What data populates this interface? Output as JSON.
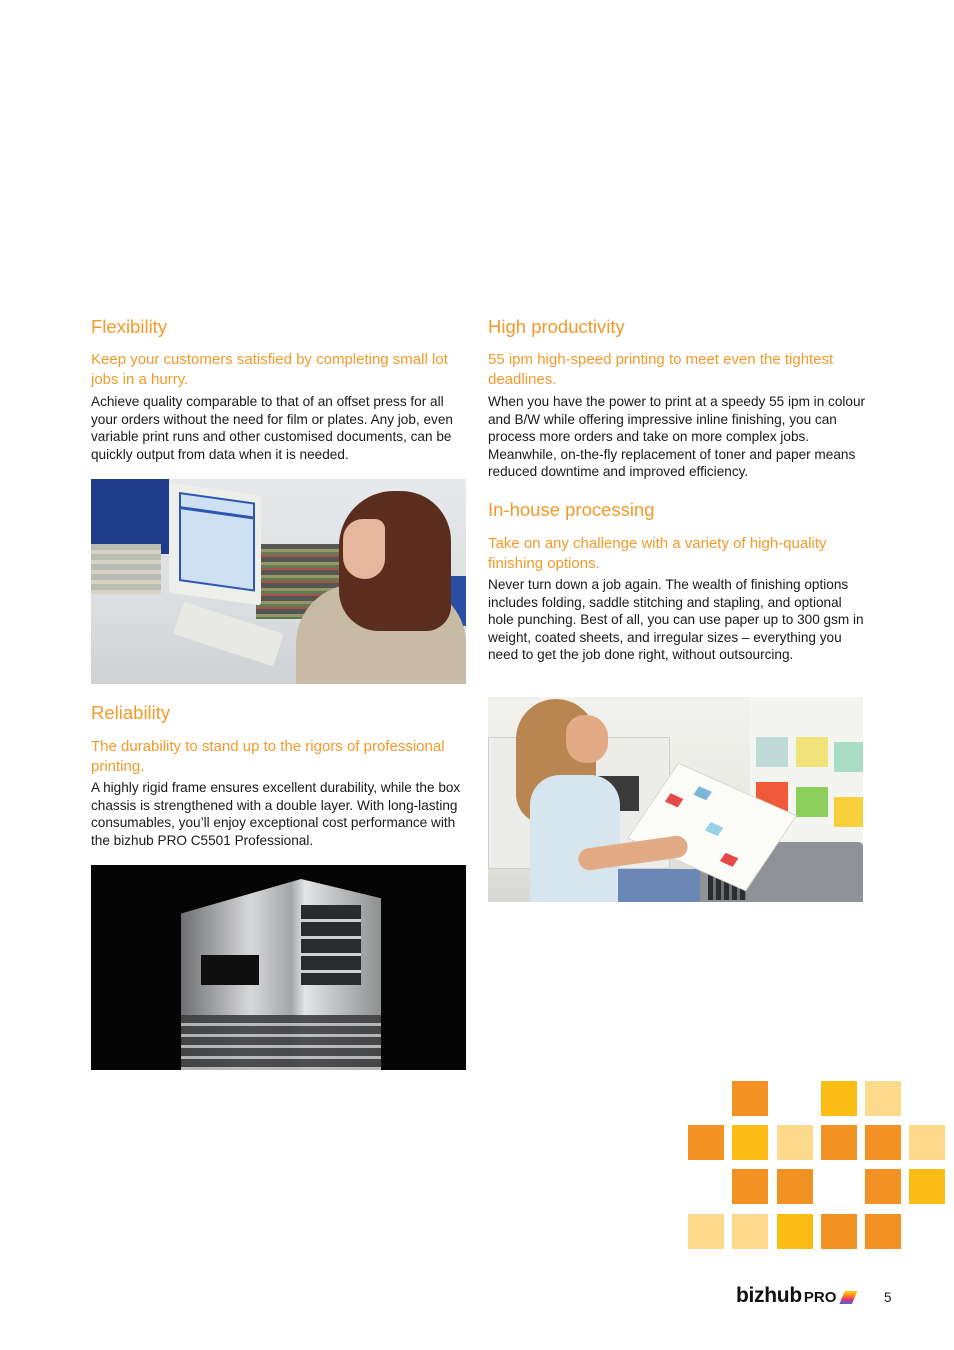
{
  "sections": {
    "flexibility": {
      "title": "Flexibility",
      "subtitle": "Keep your customers satisfied by completing small lot jobs in a hurry.",
      "body": "Achieve quality comparable to that of an offset press for all your orders without the need for film or plates. Any job, even variable print runs and other customised documents, can be quickly output from data when it is needed."
    },
    "reliability": {
      "title": "Reliability",
      "subtitle": "The durability to stand up to the rigors of professional printing.",
      "body": "A highly rigid frame ensures excellent durability, while the box chassis is strengthened with a double layer. With long-lasting consumables, you’ll enjoy exceptional cost performance with the bizhub PRO C5501 Professional."
    },
    "productivity": {
      "title": "High productivity",
      "subtitle": "55 ipm high-speed printing to meet even the tightest deadlines.",
      "body": "When you have the power to print at a speedy 55 ipm in colour and B/W while offering impressive inline finishing, you can process more orders and take on more complex jobs. Meanwhile, on-the-fly replacement of toner and paper means reduced downtime and improved efficiency."
    },
    "inhouse": {
      "title": "In-house processing",
      "subtitle": "Take on any challenge with a variety of high-quality finishing options.",
      "body": "Never turn down a job again. The wealth of finishing options includes folding, saddle stitching and stapling, and optional hole punching. Best of all, you can use paper up to 300 gsm in weight, coated sheets, and irregular sizes – everything you need to get the job done right, without outsourcing."
    }
  },
  "images": {
    "computer": "photo-woman-at-computer",
    "chassis": "photo-printer-chassis",
    "print": "photo-woman-holding-print"
  },
  "colors": {
    "accent": "#f39a2a",
    "square_dark": "#f39224",
    "square_yellow": "#fbbd14",
    "square_light": "#fdd98c"
  },
  "decor_squares": [
    [
      "",
      "dark",
      "",
      "yellow",
      "light",
      ""
    ],
    [
      "dark",
      "yellow",
      "light",
      "dark",
      "dark",
      "light"
    ],
    [
      "",
      "dark",
      "dark",
      "",
      "dark",
      "yellow"
    ],
    [
      "light",
      "light",
      "yellow",
      "dark",
      "dark",
      ""
    ]
  ],
  "footer": {
    "logo_main": "bizhub",
    "logo_suffix": "PRO",
    "page_number": "5"
  }
}
